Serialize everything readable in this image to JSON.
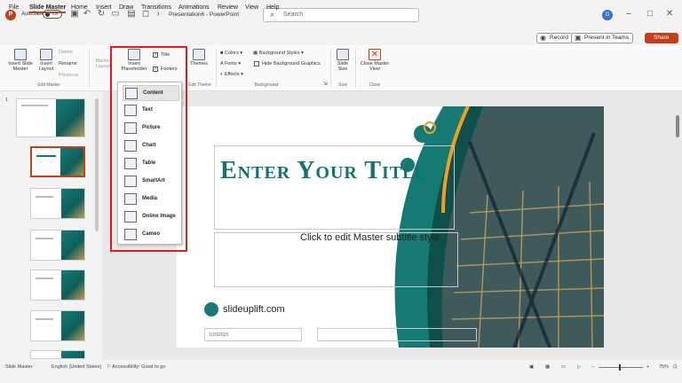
{
  "titlebar": {
    "logo": "P",
    "autosave": "AutoSave",
    "toggle": "Off",
    "title": "Presentation6 - PowerPoint",
    "search_placeholder": "Search",
    "user_initial": "G"
  },
  "menu": [
    "File",
    "Slide Master",
    "Home",
    "Insert",
    "Draw",
    "Transitions",
    "Animations",
    "Review",
    "View",
    "Help"
  ],
  "menu_active": "Slide Master",
  "top_buttons": {
    "record": "Record",
    "teams": "Present in Teams",
    "share": "Share"
  },
  "ribbon": {
    "insert_slide_master": "Insert Slide Master",
    "insert_layout": "Insert Layout",
    "delete": "Delete",
    "rename": "Rename",
    "preserve": "Preserve",
    "master_layout": "Master Layout",
    "edit_master_group": "Edit Master",
    "insert_placeholder": "Insert Placeholder",
    "title_chk": "Title",
    "footers_chk": "Footers",
    "themes": "Themes",
    "edit_theme_group": "Edit Theme",
    "colors": "Colors",
    "fonts": "Fonts",
    "effects": "Effects",
    "bg_styles": "Background Styles",
    "hide_bg": "Hide Background Graphics",
    "background_group": "Background",
    "slide_size": "Slide Size",
    "size_group": "Size",
    "close_master": "Close Master View",
    "close_group": "Close"
  },
  "dropdown": [
    {
      "label": "Content",
      "icon": "content-icon"
    },
    {
      "label": "Text",
      "icon": "text-icon"
    },
    {
      "label": "Picture",
      "icon": "picture-icon"
    },
    {
      "label": "Chart",
      "icon": "chart-icon"
    },
    {
      "label": "Table",
      "icon": "table-icon"
    },
    {
      "label": "SmartArt",
      "icon": "smartart-icon"
    },
    {
      "label": "Media",
      "icon": "media-icon"
    },
    {
      "label": "Online Image",
      "icon": "online-image-icon"
    },
    {
      "label": "Cameo",
      "icon": "cameo-icon"
    }
  ],
  "slides": {
    "master_num": "1"
  },
  "canvas": {
    "title": "Enter Your Title",
    "subtitle": "Click to edit Master subtitle style",
    "logo": "slideuplift.com",
    "date": "1/15/2025"
  },
  "status": {
    "view": "Slide Master",
    "language": "English (United States)",
    "accessibility": "Accessibility: Good to go",
    "zoom": "75%"
  },
  "colors": {
    "accent": "#c43e1c",
    "teal": "#157a73",
    "highlight": "#e21b1b"
  }
}
